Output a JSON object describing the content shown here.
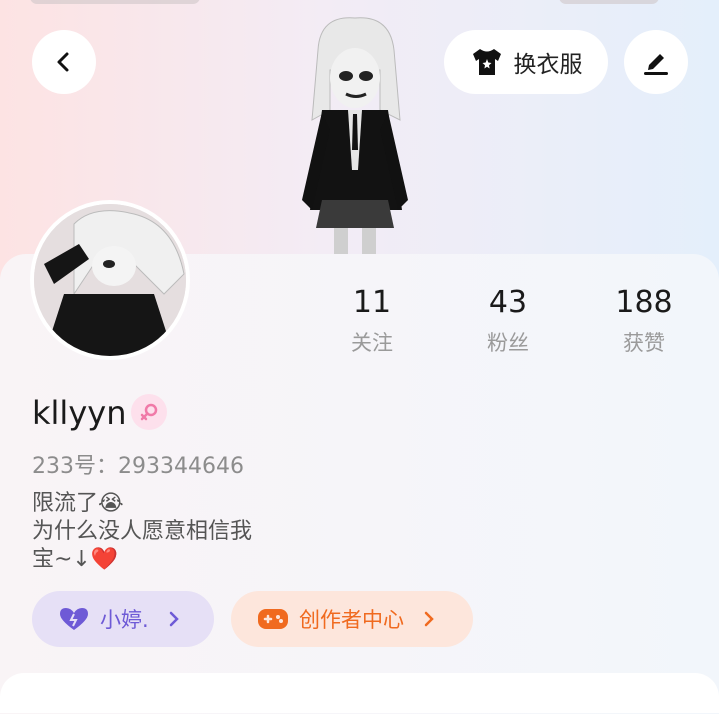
{
  "header": {
    "back_icon": "chevron-left-icon",
    "outfit_button_label": "换衣服",
    "outfit_icon": "shirt-icon",
    "edit_icon": "pen-icon"
  },
  "profile": {
    "username": "kllyyn",
    "gender_icon": "female-icon",
    "uid": "233号：293344646",
    "bio_lines": [
      "限流了😭",
      "为什么没人愿意相信我",
      "宝~↓❤️"
    ]
  },
  "stats": [
    {
      "value": "11",
      "label": "关注"
    },
    {
      "value": "43",
      "label": "粉丝"
    },
    {
      "value": "188",
      "label": "获赞"
    }
  ],
  "chips": {
    "lover_label": "小婷.",
    "creator_label": "创作者中心"
  },
  "colors": {
    "lover_accent": "#6e5ad6",
    "creator_accent": "#f06a1f",
    "female_accent": "#f07aa8"
  }
}
